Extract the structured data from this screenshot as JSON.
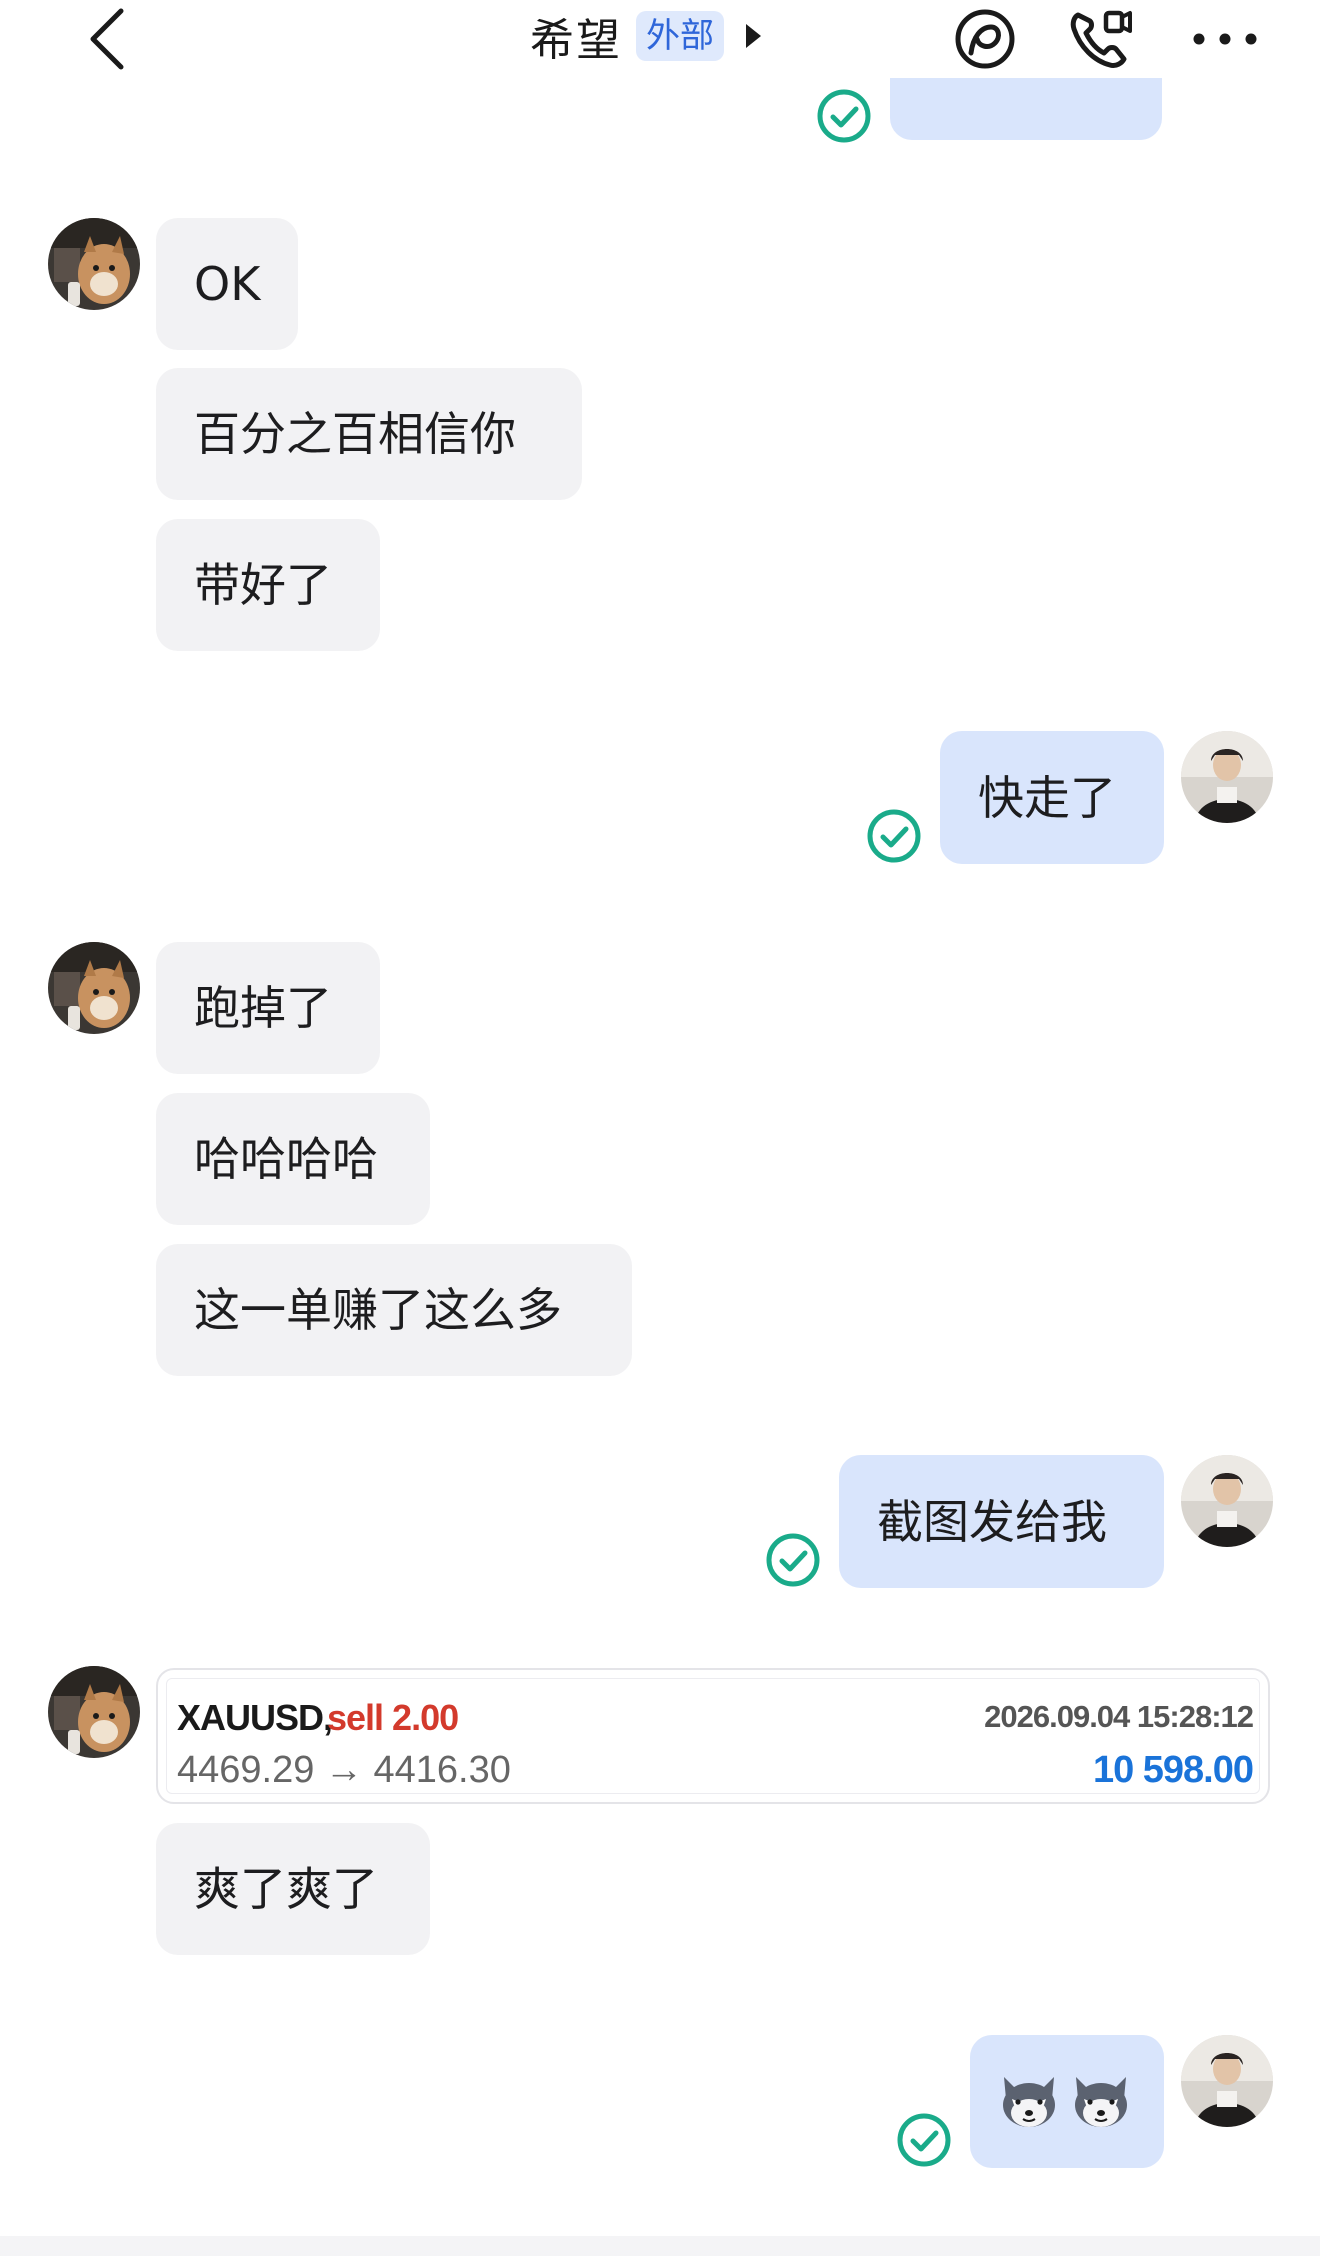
{
  "header": {
    "title": "希望",
    "external_badge": "外部",
    "icons": {
      "back": "chevron-left-icon",
      "title_arrow": "triangle-right-icon",
      "share": "share-circle-icon",
      "call": "phone-video-icon",
      "more": "more-dots-icon"
    }
  },
  "colors": {
    "incoming_bubble": "#f2f2f4",
    "outgoing_bubble": "#d9e5fc",
    "read_check": "#1aab8a",
    "badge_text": "#2f66d9",
    "sell_red": "#d33a2c",
    "profit_blue": "#1a73d9"
  },
  "messages": [
    {
      "from": "them",
      "text": "OK"
    },
    {
      "from": "them",
      "text": "百分之百相信你"
    },
    {
      "from": "them",
      "text": "带好了"
    },
    {
      "from": "me",
      "text": "快走了"
    },
    {
      "from": "them",
      "text": "跑掉了"
    },
    {
      "from": "them",
      "text": "哈哈哈哈"
    },
    {
      "from": "them",
      "text": "这一单赚了这么多"
    },
    {
      "from": "me",
      "text": "截图发给我"
    },
    {
      "from": "them",
      "text": "爽了爽了"
    },
    {
      "from": "me",
      "text": "wolf-face-emoji x2"
    }
  ],
  "trade_card": {
    "symbol": "XAUUSD,",
    "side": "sell 2.00",
    "prices": "4469.29 → 4416.30",
    "datetime": "2026.09.04 15:28:12",
    "profit": "10 598.00"
  }
}
